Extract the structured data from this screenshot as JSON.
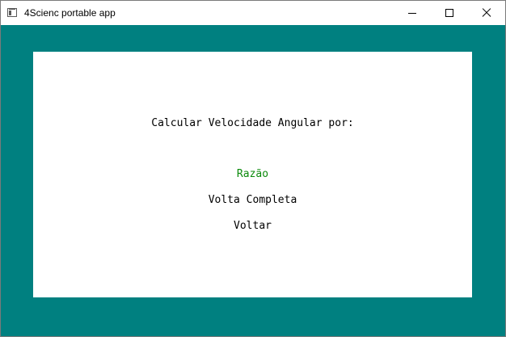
{
  "window": {
    "title": "4Scienc portable app",
    "controls": {
      "minimize_icon": "minimize-icon",
      "maximize_icon": "maximize-icon",
      "close_icon": "close-icon"
    }
  },
  "colors": {
    "background": "#008080",
    "panel": "#ffffff",
    "selected_option": "#0b8a0b"
  },
  "menu": {
    "heading": "Calcular Velocidade Angular por:",
    "options": [
      {
        "label": "Razão",
        "selected": true
      },
      {
        "label": "Volta Completa",
        "selected": false
      },
      {
        "label": "Voltar",
        "selected": false
      }
    ]
  }
}
